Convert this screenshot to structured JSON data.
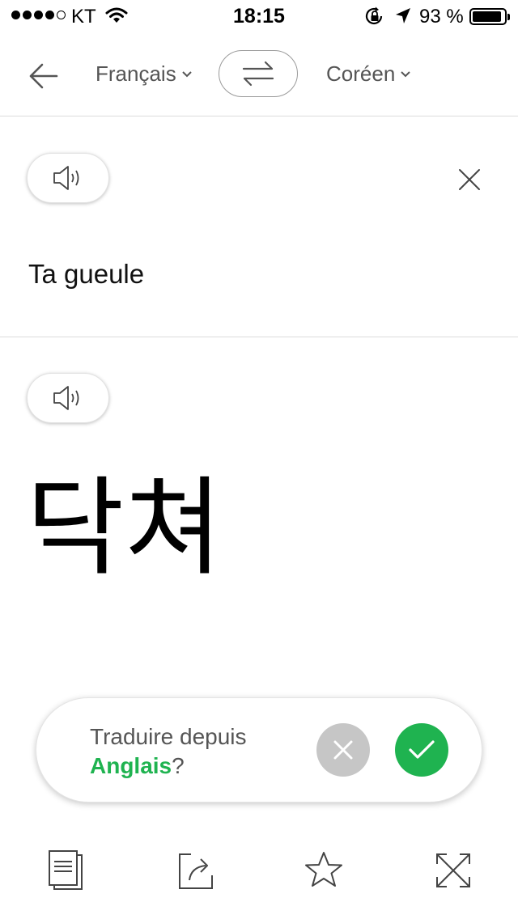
{
  "status_bar": {
    "carrier": "KT",
    "time": "18:15",
    "battery_percent": "93 %",
    "battery_level": 0.93,
    "signal_bars_filled": 4,
    "signal_bars_total": 5
  },
  "header": {
    "source_language": "Français",
    "target_language": "Coréen"
  },
  "source": {
    "text": "Ta gueule"
  },
  "result": {
    "text": "닥쳐"
  },
  "suggestion": {
    "prefix": "Traduire depuis",
    "language": "Anglais",
    "suffix": "?"
  },
  "colors": {
    "accent_green": "#1fb350",
    "reject_gray": "#c6c6c6",
    "divider": "#dcdcdc"
  },
  "icons": {
    "back": "arrow-left-icon",
    "swap": "swap-arrows-icon",
    "speaker": "speaker-icon",
    "clear": "close-icon",
    "reject": "x-icon",
    "accept": "check-icon",
    "copy": "copy-icon",
    "share": "share-icon",
    "favorite": "star-icon",
    "fullscreen": "expand-icon"
  }
}
